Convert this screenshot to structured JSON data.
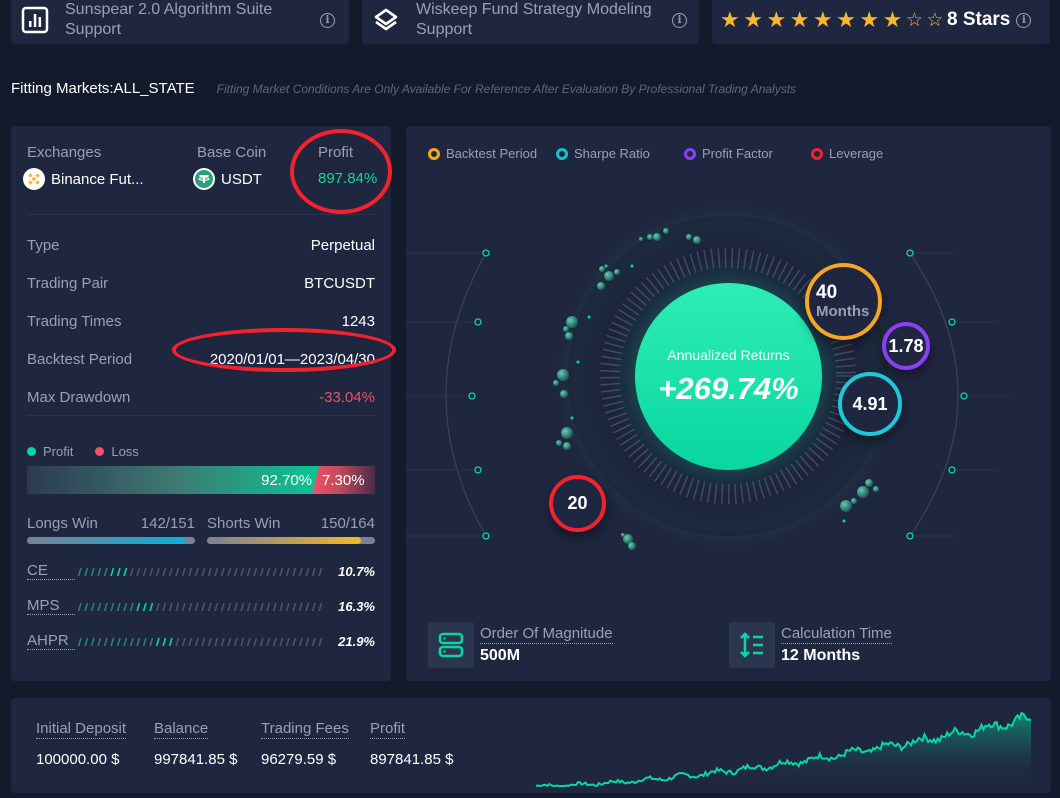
{
  "top_cards": [
    {
      "icon": "bar-chart-icon",
      "title": "Sunspear 2.0 Algorithm Suite Support"
    },
    {
      "icon": "layers-icon",
      "title": "Wiskeep Fund Strategy Modeling Support"
    }
  ],
  "rating": {
    "stars_filled": 8,
    "stars_total": 10,
    "label": "8 Stars"
  },
  "fitting": {
    "title": "Fitting Markets:ALL_STATE",
    "note": "Fitting Market Conditions Are Only Available For Reference After Evaluation By Professional Trading Analysts"
  },
  "summary": {
    "exchanges_label": "Exchanges",
    "exchanges_value": "Binance Fut...",
    "base_coin_label": "Base Coin",
    "base_coin_value": "USDT",
    "profit_label": "Profit",
    "profit_value": "897.84%"
  },
  "details": [
    {
      "label": "Type",
      "value": "Perpetual"
    },
    {
      "label": "Trading Pair",
      "value": "BTCUSDT"
    },
    {
      "label": "Trading Times",
      "value": "1243"
    },
    {
      "label": "Backtest Period",
      "value": "2020/01/01—2023/04/30"
    },
    {
      "label": "Max Drawdown",
      "value": "-33.04%"
    }
  ],
  "profit_loss": {
    "profit_label": "Profit",
    "loss_label": "Loss",
    "profit_pct": "92.70%",
    "loss_pct": "7.30%",
    "profit_fraction": 0.927
  },
  "longs_win": {
    "label": "Longs Win",
    "value": "142/151",
    "fraction": 0.94
  },
  "shorts_win": {
    "label": "Shorts Win",
    "value": "150/164",
    "fraction": 0.915
  },
  "metrics": [
    {
      "name": "CE",
      "value": "10.7%",
      "fraction": 0.107
    },
    {
      "name": "MPS",
      "value": "16.3%",
      "fraction": 0.163
    },
    {
      "name": "AHPR",
      "value": "21.9%",
      "fraction": 0.219
    }
  ],
  "legend": [
    {
      "label": "Backtest Period",
      "color": "#f5a623"
    },
    {
      "label": "Sharpe Ratio",
      "color": "#13c2c2"
    },
    {
      "label": "Profit Factor",
      "color": "#8c3ef5"
    },
    {
      "label": "Leverage",
      "color": "#f5222d"
    }
  ],
  "core": {
    "title": "Annualized Returns",
    "value": "+269.74%"
  },
  "bubbles": {
    "backtest_period": {
      "value": "40",
      "unit": "Months"
    },
    "profit_factor": {
      "value": "1.78"
    },
    "sharpe_ratio": {
      "value": "4.91"
    },
    "leverage": {
      "value": "20"
    }
  },
  "stats": [
    {
      "icon": "server-icon",
      "label": "Order Of Magnitude",
      "value": "500M"
    },
    {
      "icon": "line-height-icon",
      "label": "Calculation Time",
      "value": "12 Months"
    }
  ],
  "account": [
    {
      "label": "Initial Deposit",
      "value": "100000.00 $"
    },
    {
      "label": "Balance",
      "value": "997841.85 $"
    },
    {
      "label": "Trading Fees",
      "value": "96279.59 $"
    },
    {
      "label": "Profit",
      "value": "897841.85 $"
    }
  ],
  "colors": {
    "accent": "#0ad6a0",
    "loss": "#ea5368",
    "panel": "#1f2640",
    "background": "#131a2b"
  }
}
